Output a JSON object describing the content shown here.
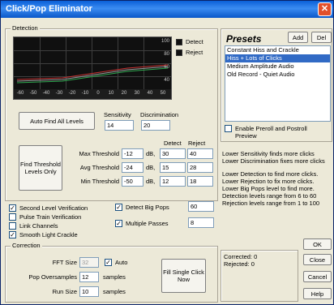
{
  "window": {
    "title": "Click/Pop Eliminator",
    "close_glyph": "✕"
  },
  "detection": {
    "group_label": "Detection",
    "legend": {
      "detect": "Detect",
      "reject": "Reject"
    },
    "graph_x_ticks": [
      "-60",
      "-50",
      "-40",
      "-30",
      "-20",
      "-10",
      "0",
      "10",
      "20",
      "30",
      "40",
      "50"
    ],
    "graph_y_ticks": [
      "100",
      "80",
      "60",
      "40"
    ],
    "auto_find_label": "Auto Find All Levels",
    "sensitivity_label": "Sensitivity",
    "sensitivity_value": "14",
    "discrimination_label": "Discrimination",
    "discrimination_value": "20",
    "find_threshold_label": "Find Threshold Levels Only",
    "col_detect": "Detect",
    "col_reject": "Reject",
    "thresholds": [
      {
        "label": "Max Threshold",
        "value": "-12",
        "unit": "dB,",
        "detect": "30",
        "reject": "40"
      },
      {
        "label": "Avg Threshold",
        "value": "-24",
        "unit": "dB,",
        "detect": "15",
        "reject": "28"
      },
      {
        "label": "Min Threshold",
        "value": "-50",
        "unit": "dB,",
        "detect": "12",
        "reject": "18"
      }
    ]
  },
  "options": {
    "second_level": {
      "label": "Second Level Verification",
      "checked": true
    },
    "pulse_train": {
      "label": "Pulse Train Verification",
      "checked": false
    },
    "link_channels": {
      "label": "Link Channels",
      "checked": false
    },
    "smooth_crackle": {
      "label": "Smooth Light Crackle",
      "checked": true
    },
    "detect_big_pops": {
      "label": "Detect Big Pops",
      "checked": true,
      "value": "60"
    },
    "multiple_passes": {
      "label": "Multiple Passes",
      "checked": true,
      "value": "8"
    }
  },
  "presets": {
    "title": "Presets",
    "add_label": "Add",
    "del_label": "Del",
    "items": [
      "Constant Hiss and Crackle",
      "Hiss + Lots of Clicks",
      "Medium Amplitude Audio",
      "Old Record - Quiet Audio"
    ],
    "selected_index": 1,
    "preroll_label": "Enable Preroll and Postroll Preview"
  },
  "help_text": [
    "Lower Sensitivity finds more clicks",
    "Lower Discrimination fixes more clicks",
    "",
    "Lower Detection to find more clicks.",
    "Lower Rejection to fix more clicks.",
    "Lower Big Pops level to find more.",
    "Detection levels range from 6 to 60",
    "Rejection levels range from 1 to 100"
  ],
  "correction": {
    "group_label": "Correction",
    "fft_label": "FFT Size",
    "fft_value": "32",
    "auto_label": "Auto",
    "auto_checked": true,
    "pop_label": "Pop Oversamples",
    "pop_value": "12",
    "pop_unit": "samples",
    "run_label": "Run Size",
    "run_value": "10",
    "run_unit": "samples",
    "fill_label": "Fill Single Click Now"
  },
  "status": {
    "corrected": "Corrected: 0",
    "rejected": "Rejected: 0"
  },
  "buttons": {
    "ok": "OK",
    "close": "Close",
    "cancel": "Cancel",
    "help": "Help"
  },
  "colors": {
    "title_blue": "#0a5fd8",
    "graph_bg": "#101010",
    "curve_red": "#c83232",
    "curve_green": "#2fa84f",
    "curve_gray": "#9a9a9a"
  }
}
